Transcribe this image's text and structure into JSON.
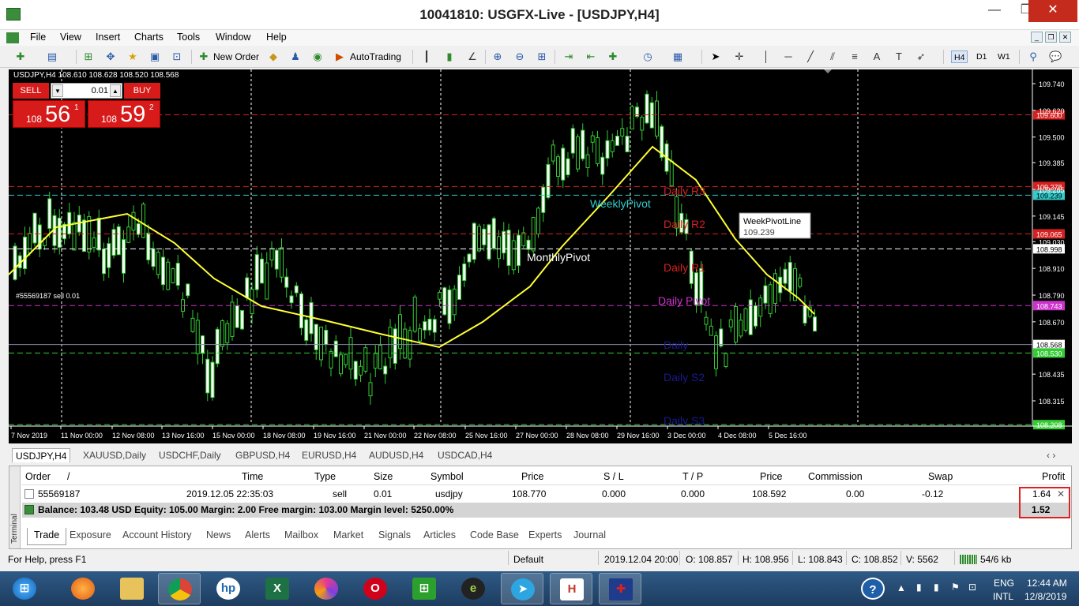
{
  "window": {
    "title": "10041810: USGFX-Live - [USDJPY,H4]",
    "min": "—",
    "max": "❐",
    "close": "✕"
  },
  "menu": [
    "File",
    "View",
    "Insert",
    "Charts",
    "Tools",
    "Window",
    "Help"
  ],
  "toolbar": {
    "new_order": "New Order",
    "autotrading": "AutoTrading",
    "timeframes": [
      "H4",
      "D1",
      "W1"
    ],
    "active_tf": "H4"
  },
  "chart": {
    "header": "USDJPY,H4  108.610 108.628 108.520 108.568",
    "sell_label": "SELL",
    "buy_label": "BUY",
    "lot": "0.01",
    "sell_small": "108",
    "sell_big": "56",
    "sell_sup": "1",
    "buy_small": "108",
    "buy_big": "59",
    "buy_sup": "2",
    "order_label": "#55569187 sell 0.01",
    "tooltip_title": "WeekPivotLine",
    "tooltip_value": "109.239",
    "price_axis": [
      "109.740",
      "109.620",
      "109.500",
      "109.385",
      "109.265",
      "109.145",
      "109.030",
      "108.910",
      "108.790",
      "108.670",
      "108.435",
      "108.315"
    ],
    "price_tags": [
      "109.600",
      "109.278",
      "109.239",
      "109.065",
      "108.998",
      "108.743",
      "108.568",
      "108.530",
      "108.208"
    ],
    "time_axis": [
      "7 Nov 2019",
      "11 Nov 00:00",
      "12 Nov 08:00",
      "13 Nov 16:00",
      "15 Nov 00:00",
      "18 Nov 08:00",
      "19 Nov 16:00",
      "21 Nov 00:00",
      "22 Nov 08:00",
      "25 Nov 16:00",
      "27 Nov 00:00",
      "28 Nov 08:00",
      "29 Nov 16:00",
      "3 Dec 00:00",
      "4 Dec 08:00",
      "5 Dec 16:00"
    ],
    "pivot_labels": {
      "r3": "Daily R3",
      "r2": "Daily R2",
      "r1": "Daily R1",
      "pivot": "Daily Pivot",
      "s1": "Daily",
      "s2": "Daily S2",
      "s3": "Daily S3",
      "weekly": "WeeklyPivot",
      "monthly": "MonthlyPivot"
    }
  },
  "chart_tabs": [
    "USDJPY,H4",
    "XAUUSD,Daily",
    "USDCHF,Daily",
    "GBPUSD,H4",
    "EURUSD,H4",
    "AUDUSD,H4",
    "USDCAD,H4"
  ],
  "terminal": {
    "side_label": "Terminal",
    "columns": [
      "Order",
      "/",
      "Time",
      "Type",
      "Size",
      "Symbol",
      "Price",
      "S / L",
      "T / P",
      "Price",
      "Commission",
      "Swap",
      "Profit"
    ],
    "order": {
      "id": "55569187",
      "time": "2019.12.05 22:35:03",
      "type": "sell",
      "size": "0.01",
      "symbol": "usdjpy",
      "price": "108.770",
      "sl": "0.000",
      "tp": "0.000",
      "cur_price": "108.592",
      "commission": "0.00",
      "swap": "-0.12",
      "profit": "1.64"
    },
    "balance_line": "Balance: 103.48 USD  Equity: 105.00  Margin: 2.00  Free margin: 103.00  Margin level: 5250.00%",
    "total_profit": "1.52",
    "tabs": [
      "Trade",
      "Exposure",
      "Account History",
      "News",
      "Alerts",
      "Mailbox",
      "Market",
      "Signals",
      "Articles",
      "Code Base",
      "Experts",
      "Journal"
    ]
  },
  "status": {
    "help": "For Help, press F1",
    "profile": "Default",
    "time": "2019.12.04 20:00",
    "open": "O: 108.857",
    "high": "H: 108.956",
    "low": "L: 108.843",
    "close": "C: 108.852",
    "volume": "V: 5562",
    "traffic": "54/6 kb"
  },
  "taskbar": {
    "lang1": "ENG",
    "lang2": "INTL",
    "time": "12:44 AM",
    "date": "12/8/2019"
  }
}
